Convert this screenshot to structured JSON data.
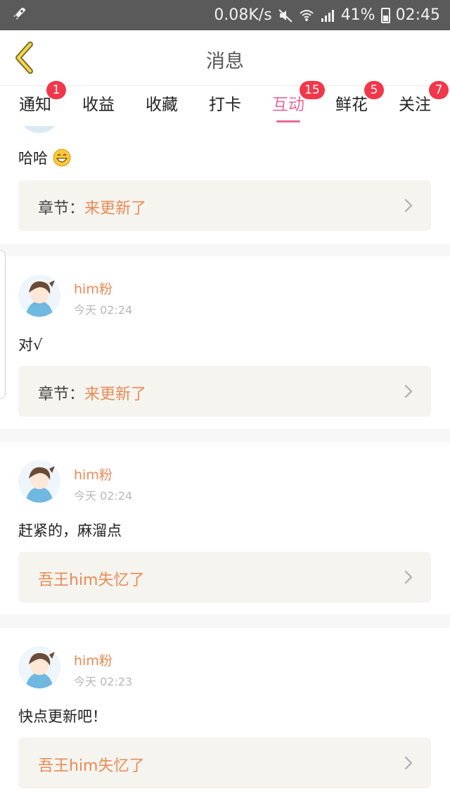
{
  "status_bar": {
    "speed": "0.08K/s",
    "battery": "41%",
    "time": "02:45"
  },
  "header": {
    "title": "消息"
  },
  "tabs": [
    {
      "label": "通知",
      "badge": "1"
    },
    {
      "label": "收益",
      "badge": ""
    },
    {
      "label": "收藏",
      "badge": ""
    },
    {
      "label": "打卡",
      "badge": ""
    },
    {
      "label": "互动",
      "badge": "15",
      "active": true
    },
    {
      "label": "鲜花",
      "badge": "5"
    },
    {
      "label": "关注",
      "badge": "7"
    }
  ],
  "messages": [
    {
      "text": "哈哈",
      "ref_prefix": "章节：",
      "ref_link": "来更新了"
    },
    {
      "user": "him粉",
      "time": "今天 02:24",
      "text": "对√",
      "ref_prefix": "章节：",
      "ref_link": "来更新了"
    },
    {
      "user": "him粉",
      "time": "今天 02:24",
      "text": "赶紧的，麻溜点",
      "ref_prefix": "",
      "ref_link": "吾王him失忆了"
    },
    {
      "user": "him粉",
      "time": "今天 02:23",
      "text": "快点更新吧！",
      "ref_prefix": "",
      "ref_link": "吾王him失忆了"
    }
  ],
  "colors": {
    "accent": "#e86a9a",
    "username": "#e88b56",
    "badge": "#f0384a",
    "status_bar": "#5a5a5a"
  },
  "icons": [
    "rocket-icon",
    "mute-icon",
    "wifi-icon",
    "signal-icon",
    "battery-icon",
    "back-chevron-icon",
    "chevron-right-icon",
    "grin-emoji-icon"
  ]
}
